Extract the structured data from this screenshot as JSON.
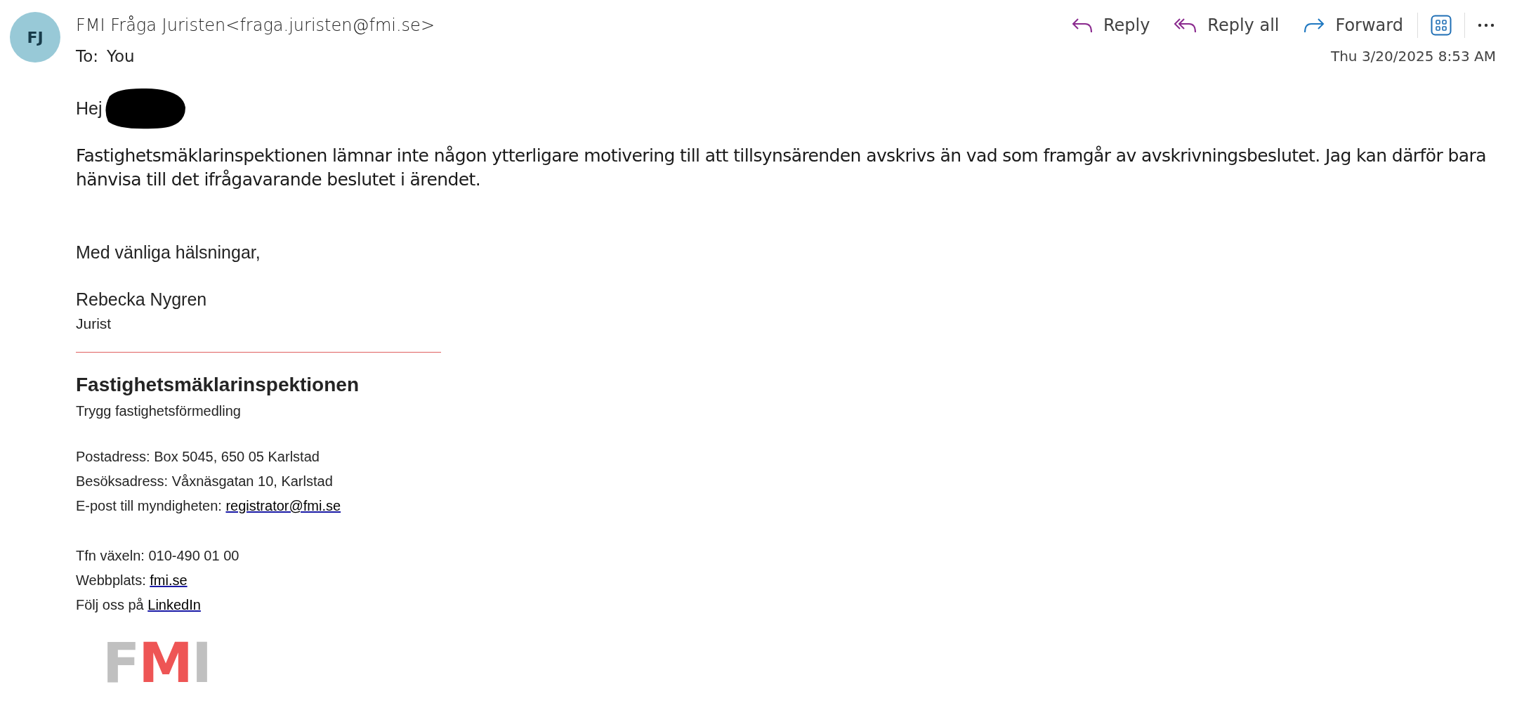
{
  "header": {
    "avatar_initials": "FJ",
    "sender": "FMI Fråga Juristen<fraga.juristen@fmi.se>",
    "to_label": "To:",
    "to_value": "You",
    "date": "Thu 3/20/2025 8:53 AM",
    "actions": [
      {
        "kind": "reply",
        "label": "Reply"
      },
      {
        "kind": "reply_all",
        "label": "Reply all"
      },
      {
        "kind": "forward",
        "label": "Forward"
      },
      {
        "kind": "apps"
      },
      {
        "kind": "more"
      }
    ]
  },
  "body": {
    "greeting": "Hej",
    "redacted": true,
    "paragraph": "Fastighetsmäklarinspektionen lämnar inte någon ytterligare motivering till att tillsynsärenden avskrivs än vad som framgår av avskrivningsbeslutet. Jag kan därför bara hänvisa till det ifrågavarande beslutet i ärendet.",
    "closing": "Med vänliga hälsningar,"
  },
  "signature": {
    "name": "Rebecka Nygren",
    "role": "Jurist",
    "organization": "Fastighetsmäklarinspektionen",
    "tagline": "Trygg fastighetsförmedling",
    "groups": [
      [
        {
          "label": "Postadress: Box 5045, 650 05 Karlstad"
        },
        {
          "label": "Besöksadress: Våxnäsgatan 10, Karlstad"
        },
        {
          "label": "E-post till myndigheten: ",
          "link": "registrator@fmi.se"
        }
      ],
      [
        {
          "label": "Tfn växeln: 010-490 01 00"
        },
        {
          "label": "Webbplats: ",
          "link": "fmi.se"
        },
        {
          "label": "Följ oss på ",
          "link": "LinkedIn"
        }
      ]
    ],
    "logo": [
      {
        "text": "F",
        "color": "#c0c0c0"
      },
      {
        "text": "M",
        "color": "#ee5555"
      },
      {
        "text": "I",
        "color": "#c0c0c0"
      }
    ]
  }
}
